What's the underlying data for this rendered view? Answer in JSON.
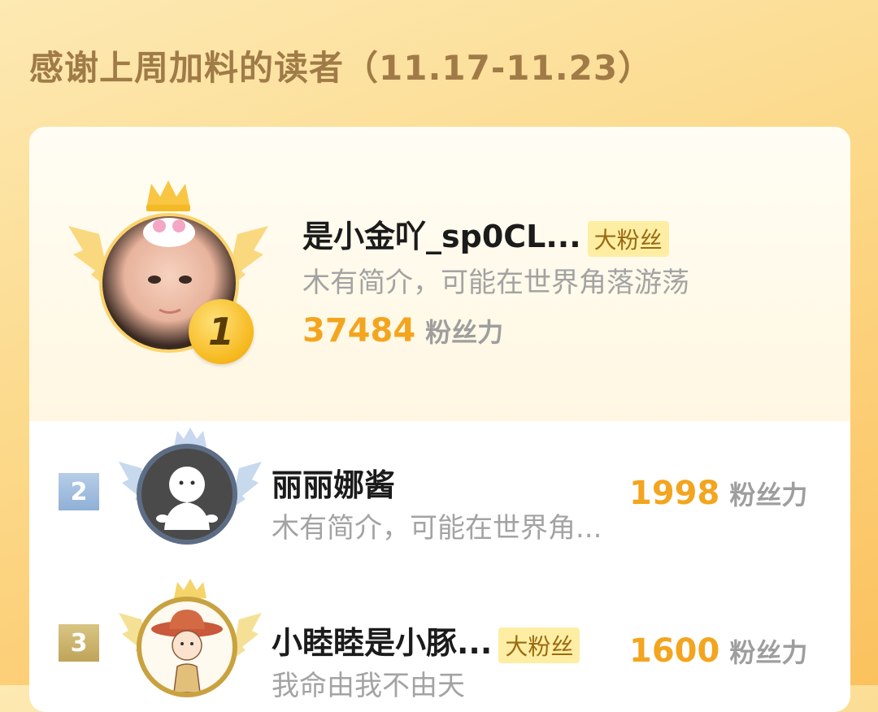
{
  "header": {
    "title": "感谢上周加料的读者（11.17-11.23）"
  },
  "colors": {
    "accent": "#f3a51f",
    "tag_bg": "#fdeea4",
    "gold": "#f6b81c",
    "silver": "#8fb0d6",
    "bronze": "#bfa458"
  },
  "readers": [
    {
      "rank": "1",
      "name": "是小金吖_sp0CL...",
      "tag": "大粉丝",
      "bio": "木有简介，可能在世界角落游荡",
      "score": "37484",
      "score_label": "粉丝力",
      "avatar_icon": "user-photo-avatar"
    },
    {
      "rank": "2",
      "name": "丽丽娜酱",
      "tag": "",
      "bio": "木有简介，可能在世界角...",
      "score": "1998",
      "score_label": "粉丝力",
      "avatar_icon": "default-ghost-avatar"
    },
    {
      "rank": "3",
      "name": "小睦睦是小豚...",
      "tag": "大粉丝",
      "bio": "我命由我不由天",
      "score": "1600",
      "score_label": "粉丝力",
      "avatar_icon": "cartoon-character-avatar"
    }
  ]
}
